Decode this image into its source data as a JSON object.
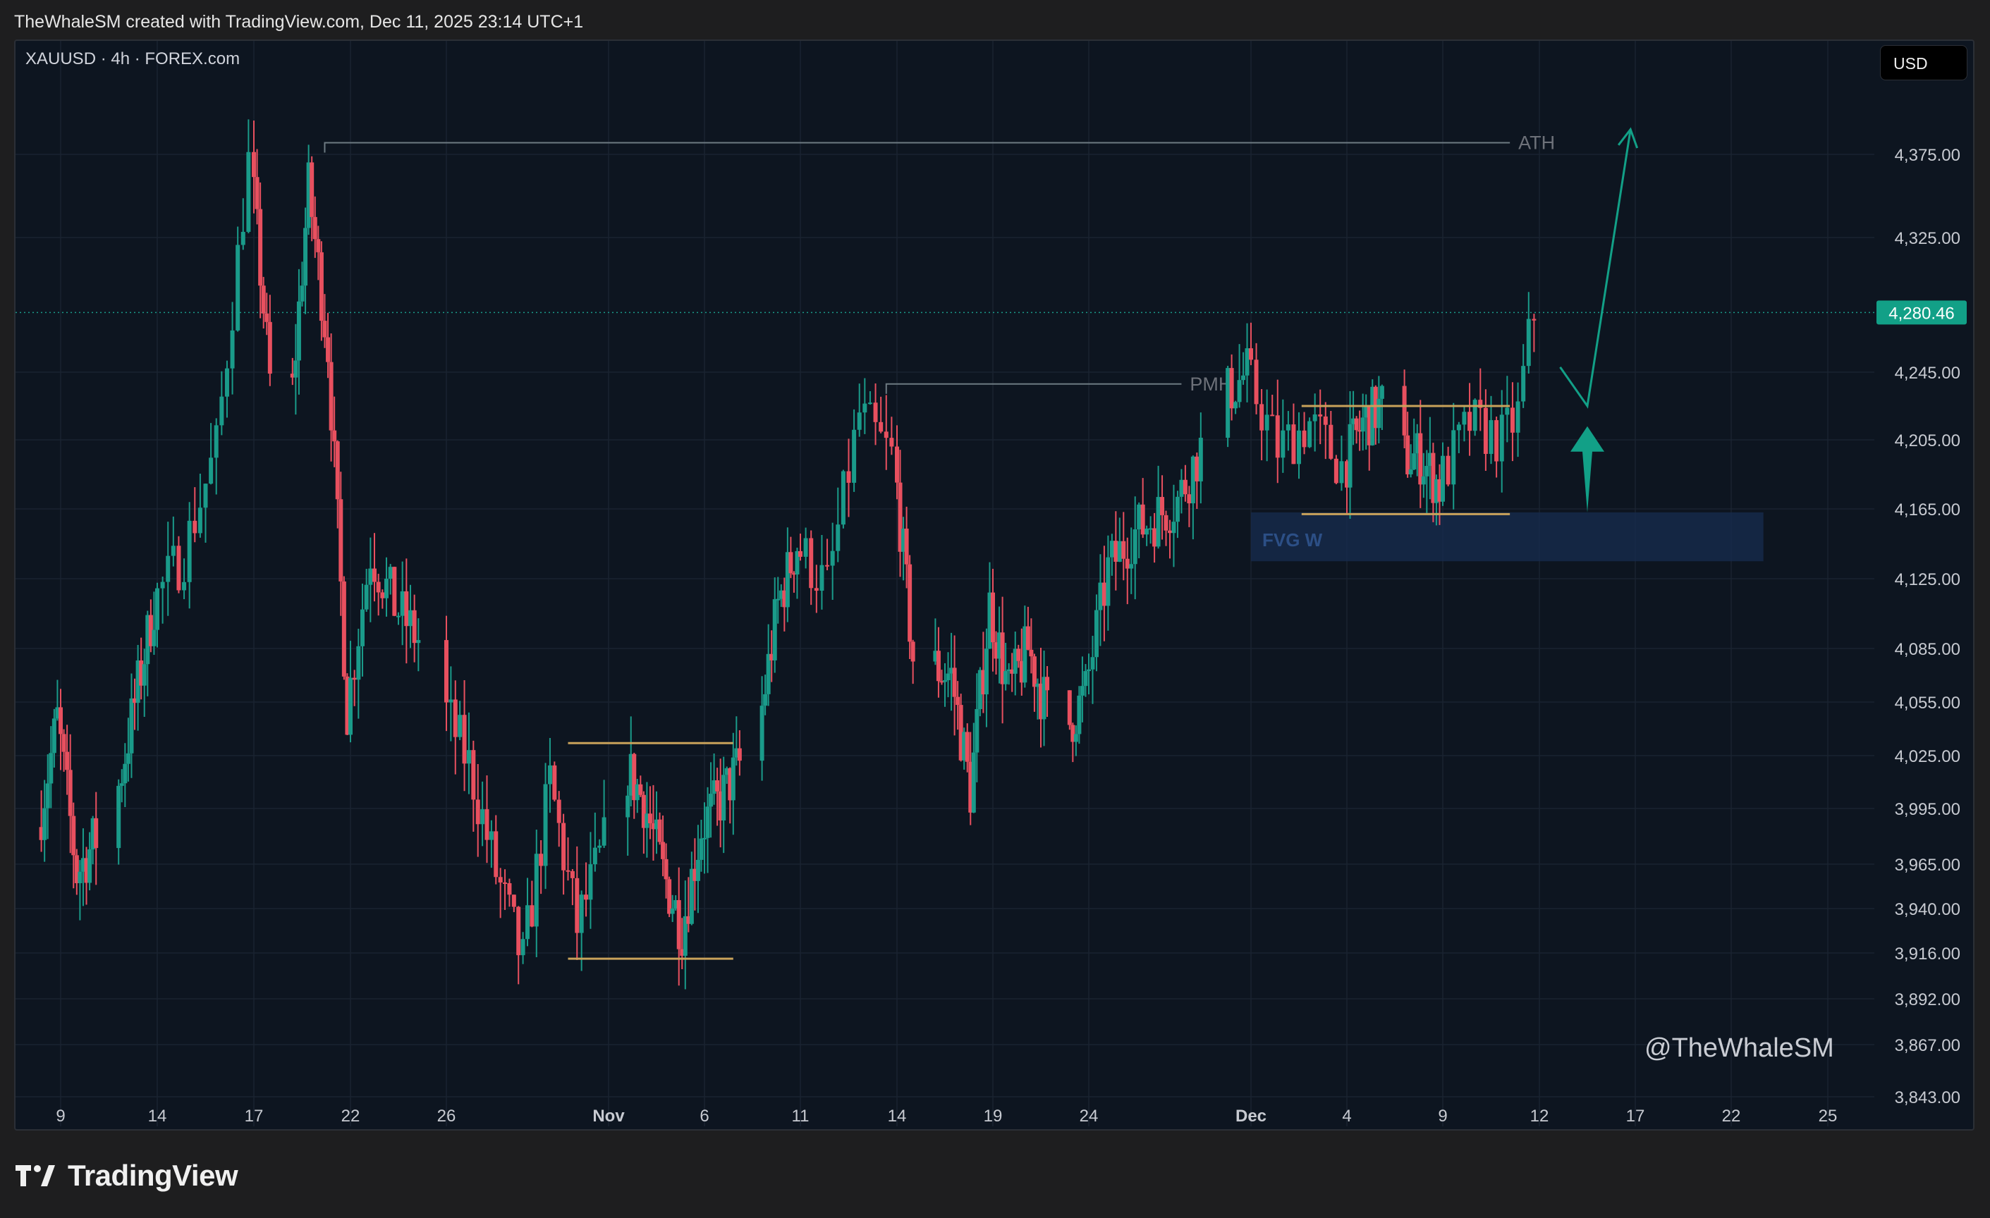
{
  "header": {
    "credit": "TheWhaleSM created with TradingView.com, Dec 11, 2025 23:14 UTC+1"
  },
  "chart": {
    "symbol": "XAUUSD · 4h · FOREX.com",
    "currency": "USD",
    "watermark": "@TheWhaleSM"
  },
  "footer": {
    "brand": "TradingView"
  },
  "colors": {
    "background": "#0d1520",
    "up": "#1a9b8a",
    "down": "#e8505f",
    "range": "#c9a25a",
    "fvg": "#16294a",
    "accent": "#12a087"
  },
  "chart_data": {
    "type": "candlestick",
    "interval": "4h",
    "y_axis": {
      "ticks": [
        3843.0,
        3867.0,
        3892.0,
        3916.0,
        3940.0,
        3965.0,
        3995.0,
        4025.0,
        4055.0,
        4085.0,
        4125.0,
        4165.0,
        4205.0,
        4245.0,
        4325.0,
        4375.0
      ],
      "tick_labels": [
        "3,843.00",
        "3,867.00",
        "3,892.00",
        "3,916.00",
        "3,940.00",
        "3,965.00",
        "3,995.00",
        "4,025.00",
        "4,055.00",
        "4,085.00",
        "4,125.00",
        "4,165.00",
        "4,205.00",
        "4,245.00",
        "4,325.00",
        "4,375.00"
      ]
    },
    "x_axis": {
      "ticks": [
        {
          "label": "9",
          "date": "2025-10-09",
          "bold": false
        },
        {
          "label": "14",
          "date": "2025-10-14",
          "bold": false
        },
        {
          "label": "17",
          "date": "2025-10-17",
          "bold": false
        },
        {
          "label": "22",
          "date": "2025-10-22",
          "bold": false
        },
        {
          "label": "26",
          "date": "2025-10-26",
          "bold": false
        },
        {
          "label": "Nov",
          "date": "2025-11-01",
          "bold": true
        },
        {
          "label": "6",
          "date": "2025-11-06",
          "bold": false
        },
        {
          "label": "11",
          "date": "2025-11-11",
          "bold": false
        },
        {
          "label": "14",
          "date": "2025-11-14",
          "bold": false
        },
        {
          "label": "19",
          "date": "2025-11-19",
          "bold": false
        },
        {
          "label": "24",
          "date": "2025-11-24",
          "bold": false
        },
        {
          "label": "Dec",
          "date": "2025-12-01",
          "bold": true
        },
        {
          "label": "4",
          "date": "2025-12-04",
          "bold": false
        },
        {
          "label": "9",
          "date": "2025-12-09",
          "bold": false
        },
        {
          "label": "12",
          "date": "2025-12-12",
          "bold": false
        },
        {
          "label": "17",
          "date": "2025-12-17",
          "bold": false
        },
        {
          "label": "22",
          "date": "2025-12-22",
          "bold": false
        },
        {
          "label": "25",
          "date": "2025-12-25",
          "bold": false
        }
      ]
    },
    "last_price": {
      "value": 4280.46,
      "label": "4,280.46"
    },
    "path": [
      [
        "2025-10-08",
        3985
      ],
      [
        "2025-10-09",
        4045
      ],
      [
        "2025-10-10",
        3960
      ],
      [
        "2025-10-12",
        3998
      ],
      [
        "2025-10-14",
        4110
      ],
      [
        "2025-10-15",
        4140
      ],
      [
        "2025-10-16",
        4200
      ],
      [
        "2025-10-17",
        4370
      ],
      [
        "2025-10-18",
        4240
      ],
      [
        "2025-10-19",
        4210
      ],
      [
        "2025-10-20",
        4355
      ],
      [
        "2025-10-21",
        4260
      ],
      [
        "2025-10-22",
        4050
      ],
      [
        "2025-10-23",
        4140
      ],
      [
        "2025-10-24",
        4110
      ],
      [
        "2025-10-25",
        4090
      ],
      [
        "2025-10-27",
        4020
      ],
      [
        "2025-10-28",
        3960
      ],
      [
        "2025-10-29",
        3910
      ],
      [
        "2025-10-30",
        4010
      ],
      [
        "2025-10-31",
        3930
      ],
      [
        "2025-11-02",
        4020
      ],
      [
        "2025-11-03",
        4000
      ],
      [
        "2025-11-04",
        3960
      ],
      [
        "2025-11-05",
        3930
      ],
      [
        "2025-11-06",
        3985
      ],
      [
        "2025-11-07",
        4000
      ],
      [
        "2025-11-09",
        4040
      ],
      [
        "2025-11-10",
        4110
      ],
      [
        "2025-11-11",
        4145
      ],
      [
        "2025-11-12",
        4120
      ],
      [
        "2025-11-13",
        4220
      ],
      [
        "2025-11-14",
        4195
      ],
      [
        "2025-11-15",
        4080
      ],
      [
        "2025-11-17",
        4070
      ],
      [
        "2025-11-18",
        4005
      ],
      [
        "2025-11-19",
        4110
      ],
      [
        "2025-11-20",
        4060
      ],
      [
        "2025-11-21",
        4085
      ],
      [
        "2025-11-22",
        4050
      ],
      [
        "2025-11-23",
        4040
      ],
      [
        "2025-11-24",
        4060
      ],
      [
        "2025-11-25",
        4130
      ],
      [
        "2025-11-26",
        4150
      ],
      [
        "2025-11-27",
        4160
      ],
      [
        "2025-11-28",
        4170
      ],
      [
        "2025-11-30",
        4230
      ],
      [
        "2025-12-01",
        4245
      ],
      [
        "2025-12-02",
        4200
      ],
      [
        "2025-12-03",
        4215
      ],
      [
        "2025-12-04",
        4190
      ],
      [
        "2025-12-05",
        4215
      ],
      [
        "2025-12-06",
        4225
      ],
      [
        "2025-12-07",
        4195
      ],
      [
        "2025-12-08",
        4195
      ],
      [
        "2025-12-09",
        4178
      ],
      [
        "2025-12-10",
        4215
      ],
      [
        "2025-12-11",
        4205
      ],
      [
        "2025-12-11 12:00",
        4220
      ],
      [
        "2025-12-11 23:00",
        4280
      ]
    ],
    "annotations": {
      "ath": {
        "label": "ATH",
        "price": 4382,
        "from": "2025-10-20 16:00",
        "to": "2025-12-11 02:00"
      },
      "pmh": {
        "label": "PMH",
        "price": 4238,
        "from": "2025-11-13 16:00",
        "to": "2025-11-28"
      },
      "range_oct_nov": {
        "high": 4032,
        "low": 3913,
        "from": "2025-10-30 12:00",
        "to": "2025-11-07 12:00"
      },
      "range_dec": {
        "high": 4225,
        "low": 4162,
        "from": "2025-12-02 14:00",
        "to": "2025-12-11 02:00"
      },
      "fvg": {
        "label": "FVG W",
        "from": "2025-12-01",
        "to": "2025-12-23",
        "high": 4163,
        "low": 4135
      },
      "projection": {
        "path": [
          [
            "2025-12-13 02:00",
            4248
          ],
          [
            "2025-12-14 12:00",
            4225
          ],
          [
            "2025-12-16 18:00",
            4390
          ]
        ],
        "impulse_arrow": {
          "date": "2025-12-14 12:00",
          "from_price": 4163,
          "to_price": 4213
        }
      }
    }
  }
}
